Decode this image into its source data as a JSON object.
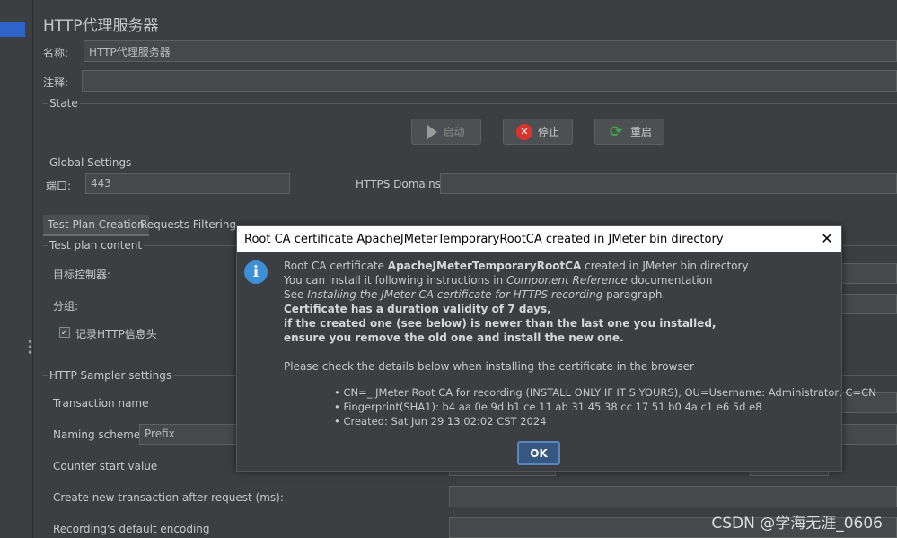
{
  "page": {
    "title": "HTTP代理服务器",
    "name_label": "名称:",
    "name_value": "HTTP代理服务器",
    "comment_label": "注释:",
    "comment_value": ""
  },
  "state": {
    "title": "State",
    "start_label": "启动",
    "stop_label": "停止",
    "restart_label": "重启"
  },
  "global": {
    "title": "Global Settings",
    "port_label": "端口:",
    "port_value": "443",
    "https_label": "HTTPS Domains:",
    "https_value": ""
  },
  "tabs": [
    {
      "label": "Test Plan Creation",
      "active": true
    },
    {
      "label": "Requests Filtering",
      "active": false
    }
  ],
  "test_plan": {
    "title": "Test plan content",
    "target_label": "目标控制器:",
    "group_label": "分组:",
    "record_headers_label": "记录HTTP信息头",
    "record_headers_checked": true
  },
  "sampler": {
    "title": "HTTP Sampler settings",
    "transaction_label": "Transaction name",
    "naming_label": "Naming scheme",
    "naming_value": "Prefix",
    "counter_label": "Counter start value",
    "new_txn_label": "Create new transaction after request (ms):",
    "encoding_label": "Recording's default encoding"
  },
  "dialog": {
    "title": "Root CA certificate ApacheJMeterTemporaryRootCA created in JMeter bin directory",
    "line1_pre": "Root CA certificate ",
    "line1_bold": "ApacheJMeterTemporaryRootCA",
    "line1_post": " created in JMeter bin directory",
    "line2_pre": "You can install it following instructions in ",
    "line2_it": "Component Reference",
    "line2_post": " documentation",
    "line3_pre": "See ",
    "line3_it": "Installing the JMeter CA certificate for HTTPS recording",
    "line3_post": " paragraph.",
    "bold1": "Certificate has a duration validity of 7 days,",
    "bold2": "if the created one (see below) is newer than the last one you installed,",
    "bold3": "ensure you remove the old one and install the new one.",
    "check": "Please check the details below when installing the certificate in the browser",
    "bullets": [
      "CN=_ JMeter Root CA for recording (INSTALL ONLY IF IT S YOURS), OU=Username: Administrator, C=CN",
      "Fingerprint(SHA1): b4 aa 0e 9d b1 ce 11 ab 31 45 38 cc 17 51 b0 4a c1 e6 5d e8",
      "Created: Sat Jun 29 13:02:02 CST 2024"
    ],
    "ok_label": "OK",
    "close_glyph": "✕"
  },
  "watermark": "CSDN @学海无涯_0606",
  "colors": {
    "background": "#3c3f41",
    "field": "#45494a",
    "dialog_title_bg": "#ffffff",
    "info_icon": "#3d8fd8",
    "ok_button": "#365880",
    "stop_icon": "#d9352e",
    "restart_icon": "#3aa64a"
  }
}
